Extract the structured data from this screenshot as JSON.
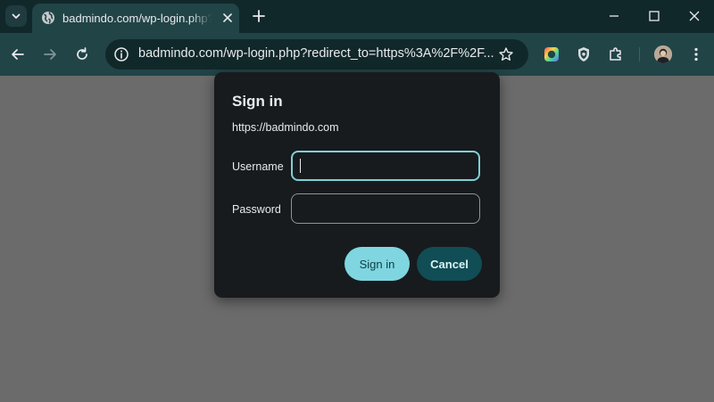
{
  "tab": {
    "title": "badmindo.com/wp-login.php?redirect_to"
  },
  "omnibox": {
    "url": "badmindo.com/wp-login.php?redirect_to=https%3A%2F%2F..."
  },
  "dialog": {
    "title": "Sign in",
    "origin": "https://badmindo.com",
    "username_label": "Username",
    "username_value": "",
    "password_label": "Password",
    "password_value": "",
    "signin_label": "Sign in",
    "cancel_label": "Cancel"
  },
  "colors": {
    "tabstrip_bg": "#11282b",
    "toolbar_bg": "#214447",
    "page_bg": "#6b6b6b",
    "dialog_bg": "#171b1e",
    "accent": "#7fd6e0",
    "cancel_bg": "#114d54"
  }
}
